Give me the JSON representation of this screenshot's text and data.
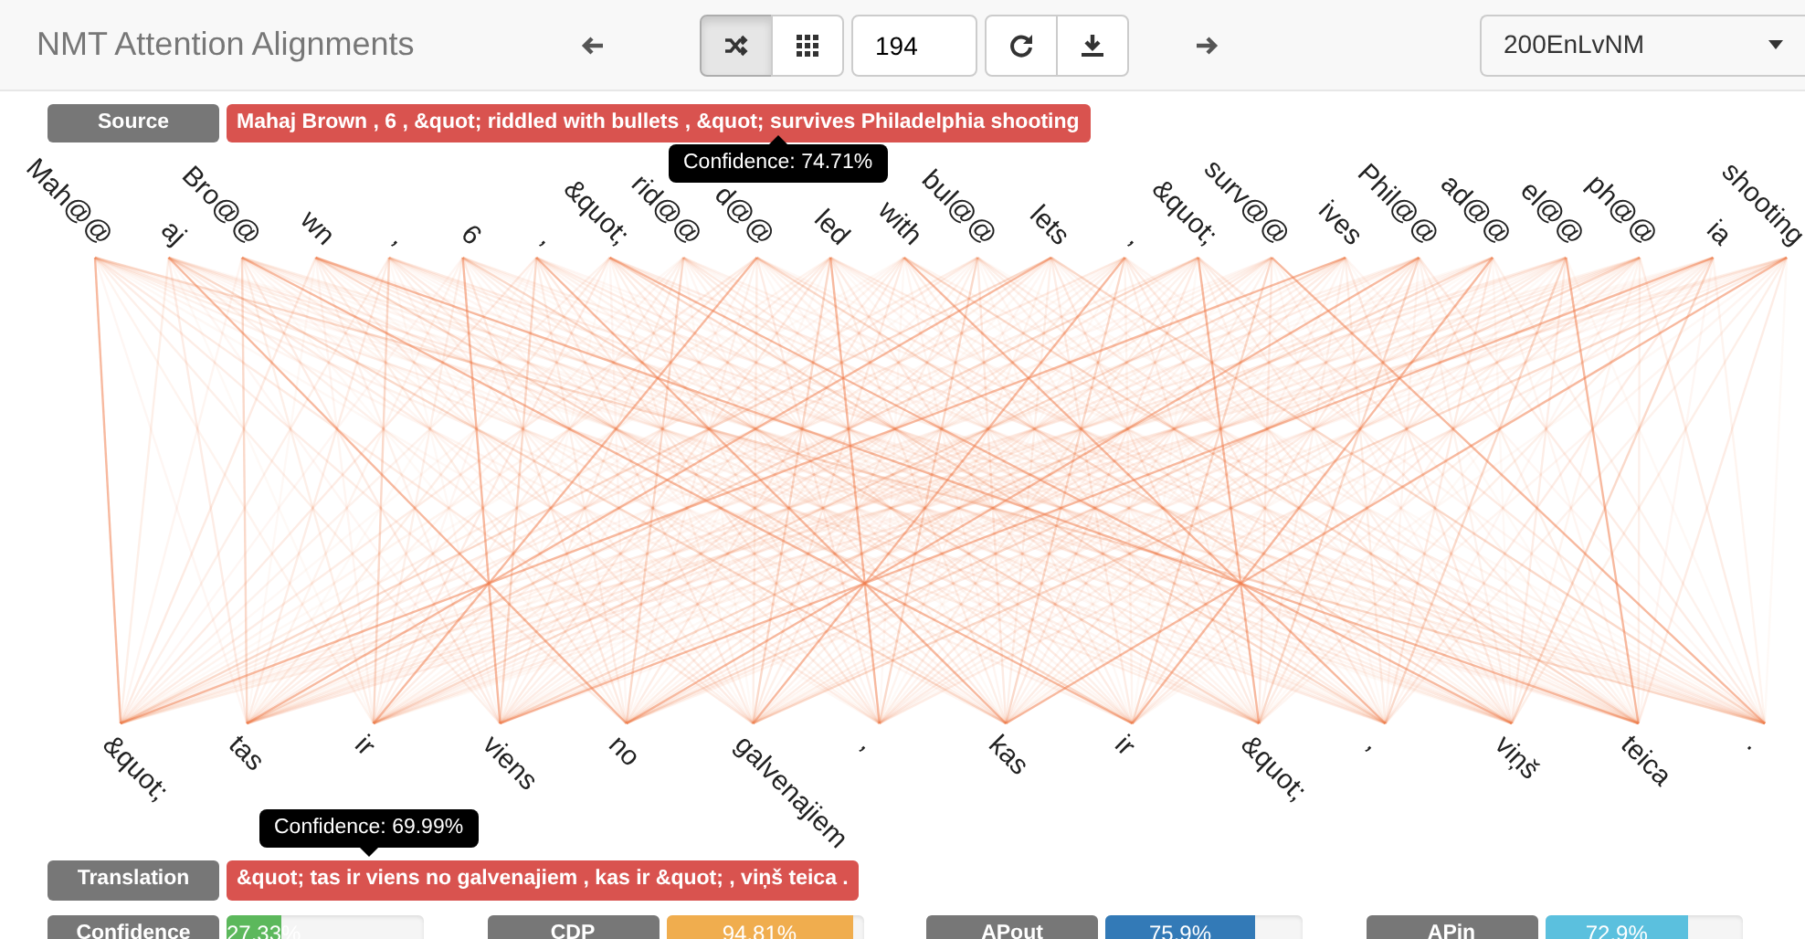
{
  "navbar": {
    "title": "NMT Attention Alignments",
    "controls": [
      {
        "kind": "prev"
      },
      {
        "kind": "shuffle",
        "selected": true
      },
      {
        "kind": "grid",
        "selected": false
      },
      {
        "kind": "number",
        "value": "194"
      },
      {
        "kind": "refresh"
      },
      {
        "kind": "download"
      },
      {
        "kind": "next"
      }
    ],
    "select": {
      "value": "200EnLvNM"
    }
  },
  "source": {
    "label": "Source",
    "text": "Mahaj Brown , 6 , &quot; riddled with bullets , &quot; survives Philadelphia shooting",
    "tooltip": "Confidence: 74.71%"
  },
  "source_tokens": [
    "Mah@@",
    "aj",
    "Bro@@",
    "wn",
    ",",
    "6",
    ",",
    "&quot;",
    "rid@@",
    "d@@",
    "led",
    "with",
    "bul@@",
    "lets",
    ",",
    "&quot;",
    "surv@@",
    "ives",
    "Phil@@",
    "ad@@",
    "el@@",
    "ph@@",
    "ia",
    "shooting"
  ],
  "target_tokens": [
    "&quot;",
    "tas",
    "ir",
    "viens",
    "no",
    "galvenajiem",
    ",",
    "kas",
    "ir",
    "&quot;",
    ",",
    "viņš",
    "teica",
    "."
  ],
  "translation": {
    "label": "Translation",
    "text": "&quot; tas ir viens no galvenajiem , kas ir &quot; , viņš teica .",
    "tooltip": "Confidence: 69.99%"
  },
  "metrics": [
    {
      "label": "Confidence",
      "reading": "27.33%",
      "level": 0.2733,
      "color": "#5cb85c"
    },
    {
      "label": "CDP",
      "reading": "94.81%",
      "level": 0.9481,
      "color": "#f0ad4e"
    },
    {
      "label": "APout",
      "reading": "75.9%",
      "level": 0.759,
      "color": "#337ab7"
    },
    {
      "label": "APin",
      "reading": "72.9%",
      "level": 0.729,
      "color": "#5bc0de"
    }
  ]
}
